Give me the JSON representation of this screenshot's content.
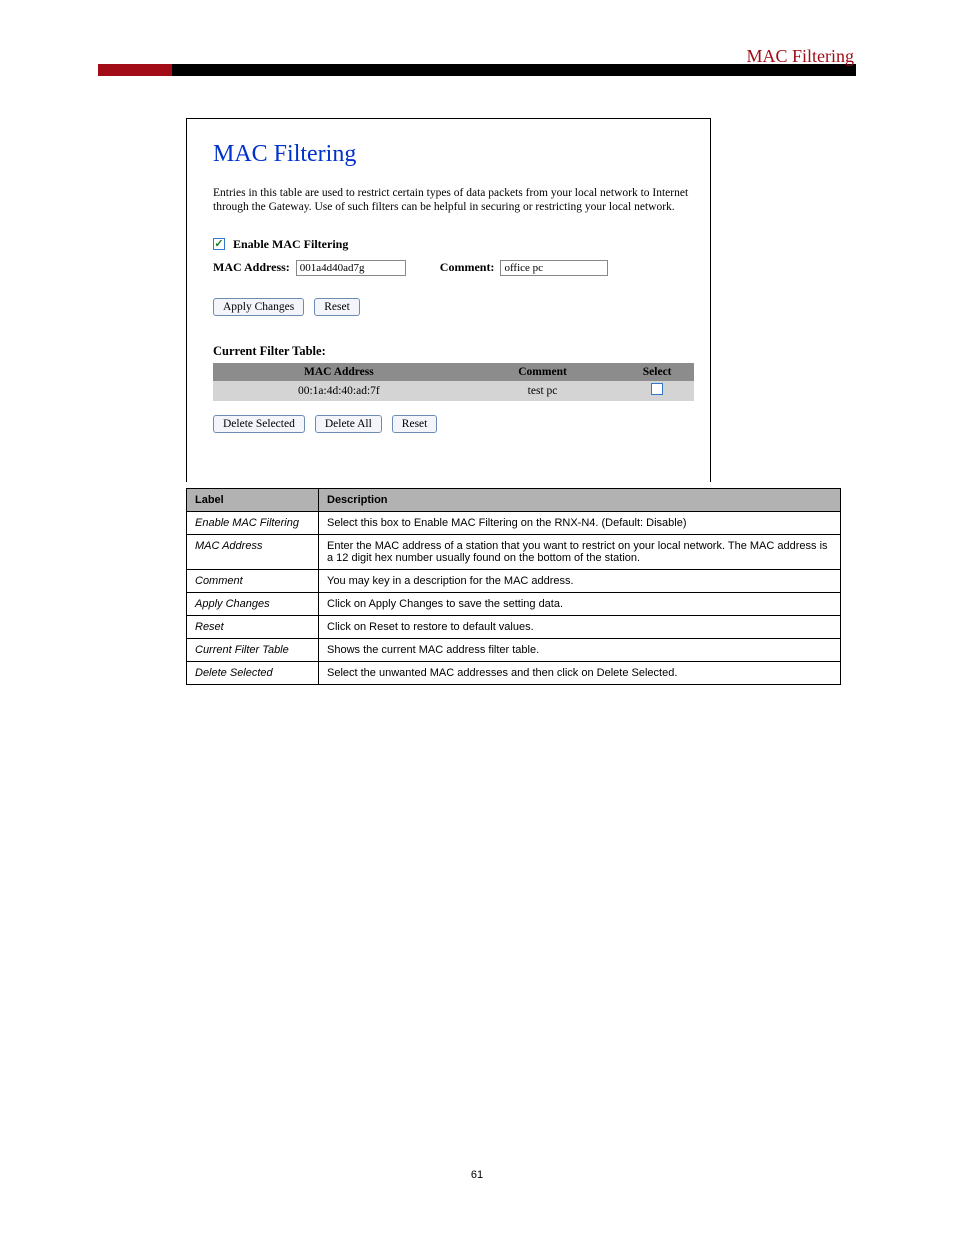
{
  "header": {
    "right": "MAC Filtering"
  },
  "screenshot": {
    "title": "MAC Filtering",
    "description": "Entries in this table are used to restrict certain types of data packets from your local network to Internet through the Gateway. Use of such filters can be helpful in securing or restricting your local network.",
    "enable_label": "Enable MAC Filtering",
    "mac_label": "MAC Address:",
    "mac_value": "001a4d40ad7g",
    "comment_label": "Comment:",
    "comment_value": "office pc",
    "btn_apply": "Apply Changes",
    "btn_reset": "Reset",
    "table_title": "Current Filter Table:",
    "table_headers": {
      "mac": "MAC Address",
      "comment": "Comment",
      "select": "Select"
    },
    "table_rows": [
      {
        "mac": "00:1a:4d:40:ad:7f",
        "comment": "test pc"
      }
    ],
    "btn_delete_selected": "Delete Selected",
    "btn_delete_all": "Delete All",
    "btn_reset2": "Reset"
  },
  "desc": {
    "head_label": "Label",
    "head_desc": "Description",
    "rows": [
      {
        "label": "Enable MAC Filtering",
        "desc": "Select this box to Enable MAC Filtering on the RNX-N4. (Default: Disable)"
      },
      {
        "label": "MAC Address",
        "desc": "Enter the MAC address of a station that you want to restrict on your local network. The MAC address is a 12 digit hex number usually found on the bottom of the station."
      },
      {
        "label": "Comment",
        "desc": "You may key in a description for the MAC address."
      },
      {
        "label": "Apply Changes",
        "desc": "Click on Apply Changes to save the setting data."
      },
      {
        "label": "Reset",
        "desc": "Click on Reset to restore to default values."
      },
      {
        "label": "Current Filter Table",
        "desc": "Shows the current MAC address filter table."
      },
      {
        "label": "Delete Selected",
        "desc": "Select the unwanted MAC addresses and then click on Delete Selected."
      }
    ]
  },
  "page_number": "61"
}
